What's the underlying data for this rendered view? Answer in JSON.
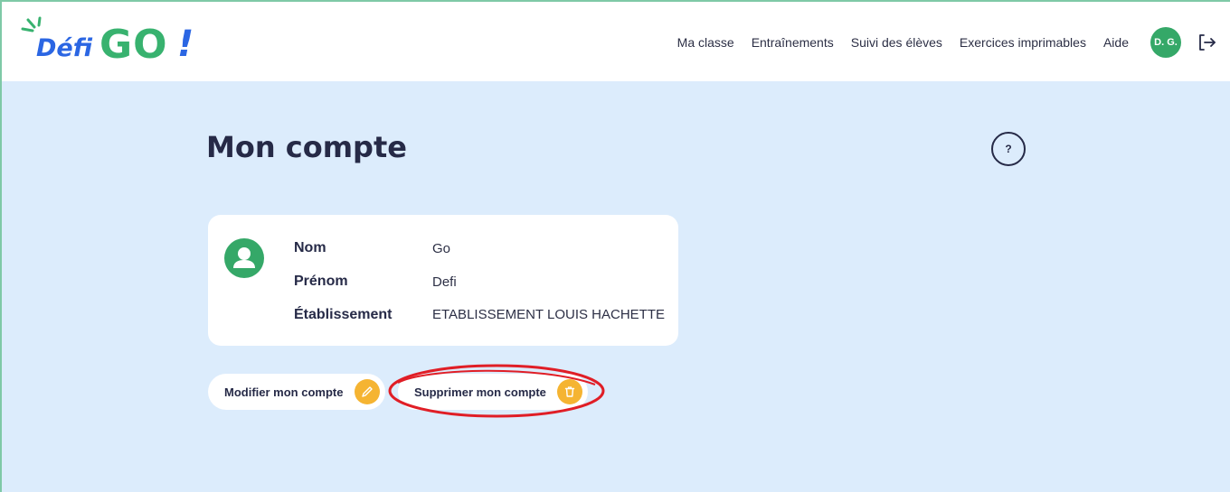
{
  "header": {
    "logo_defi": "Défi",
    "logo_go": "GO",
    "logo_bang": "!",
    "nav": [
      "Ma classe",
      "Entraînements",
      "Suivi des élèves",
      "Exercices imprimables",
      "Aide"
    ],
    "user_initials": "D. G.",
    "logout_icon": "logout-icon"
  },
  "page": {
    "title": "Mon compte",
    "help_label": "?"
  },
  "account": {
    "fields": [
      {
        "label": "Nom",
        "value": "Go"
      },
      {
        "label": "Prénom",
        "value": "Defi"
      },
      {
        "label": "Établissement",
        "value": "ETABLISSEMENT LOUIS HACHETTE"
      }
    ]
  },
  "actions": {
    "edit_label": "Modifier mon compte",
    "delete_label": "Supprimer mon compte"
  },
  "colors": {
    "brand_green": "#35a868",
    "brand_blue": "#2b66e3",
    "accent_yellow": "#f5b432",
    "background": "#dcecfc",
    "annotation_red": "#e01e26"
  }
}
